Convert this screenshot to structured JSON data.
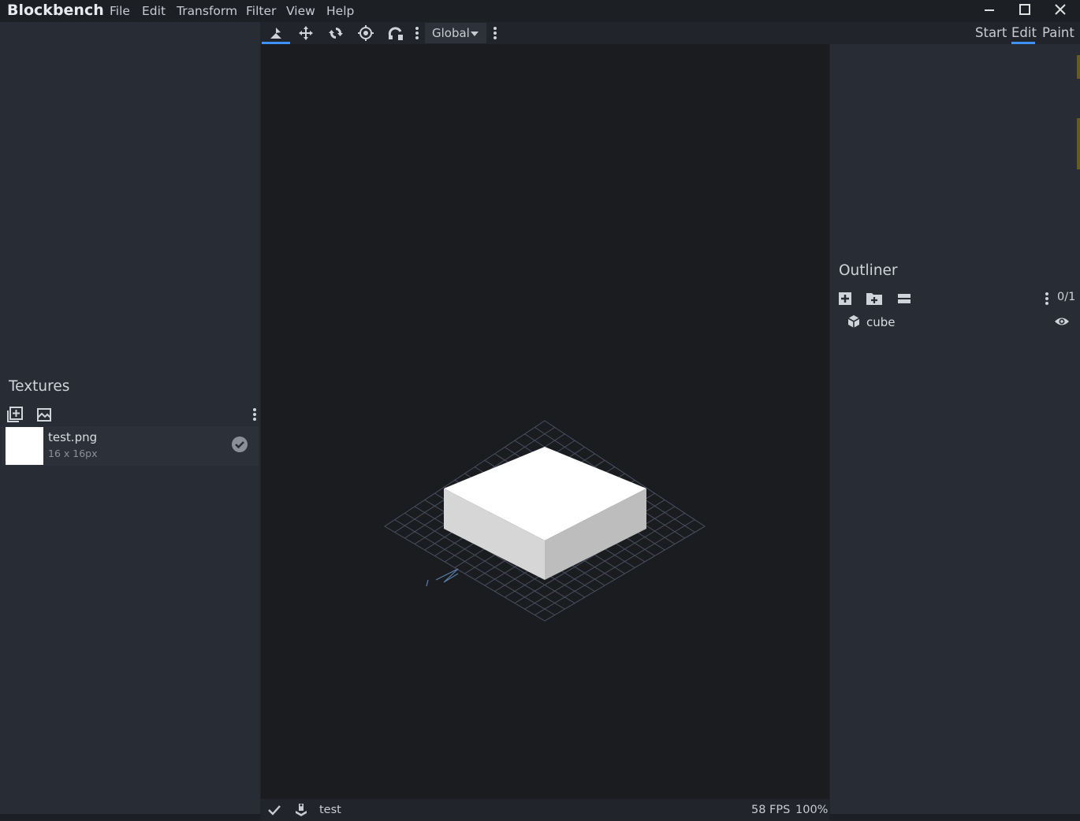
{
  "app": {
    "title": "Blockbench"
  },
  "menu": [
    "File",
    "Edit",
    "Transform",
    "Filter",
    "View",
    "Help"
  ],
  "window_controls": {
    "minimize_icon": "minimize-icon",
    "maximize_icon": "maximize-icon",
    "close_icon": "close-icon"
  },
  "toolbar": {
    "tools": [
      "move-tool",
      "resize-tool",
      "rotate-tool",
      "pivot-tool",
      "vertex-snap-tool"
    ],
    "active_tool": "move-tool",
    "space_dropdown": "Global"
  },
  "modes": [
    "Start",
    "Edit",
    "Paint"
  ],
  "active_mode": "Edit",
  "textures": {
    "title": "Textures",
    "items": [
      {
        "name": "test.png",
        "size": "16 x 16px",
        "color": "#ffffff"
      }
    ]
  },
  "outliner": {
    "title": "Outliner",
    "count": "0/1",
    "items": [
      {
        "name": "cube",
        "visible": true
      }
    ]
  },
  "status": {
    "project": "test",
    "fps": "58 FPS",
    "zoom": "100%"
  },
  "colors": {
    "accent": "#3e90ff",
    "background": "#21252b",
    "panel": "#282c34",
    "viewport": "#1a1c20"
  }
}
